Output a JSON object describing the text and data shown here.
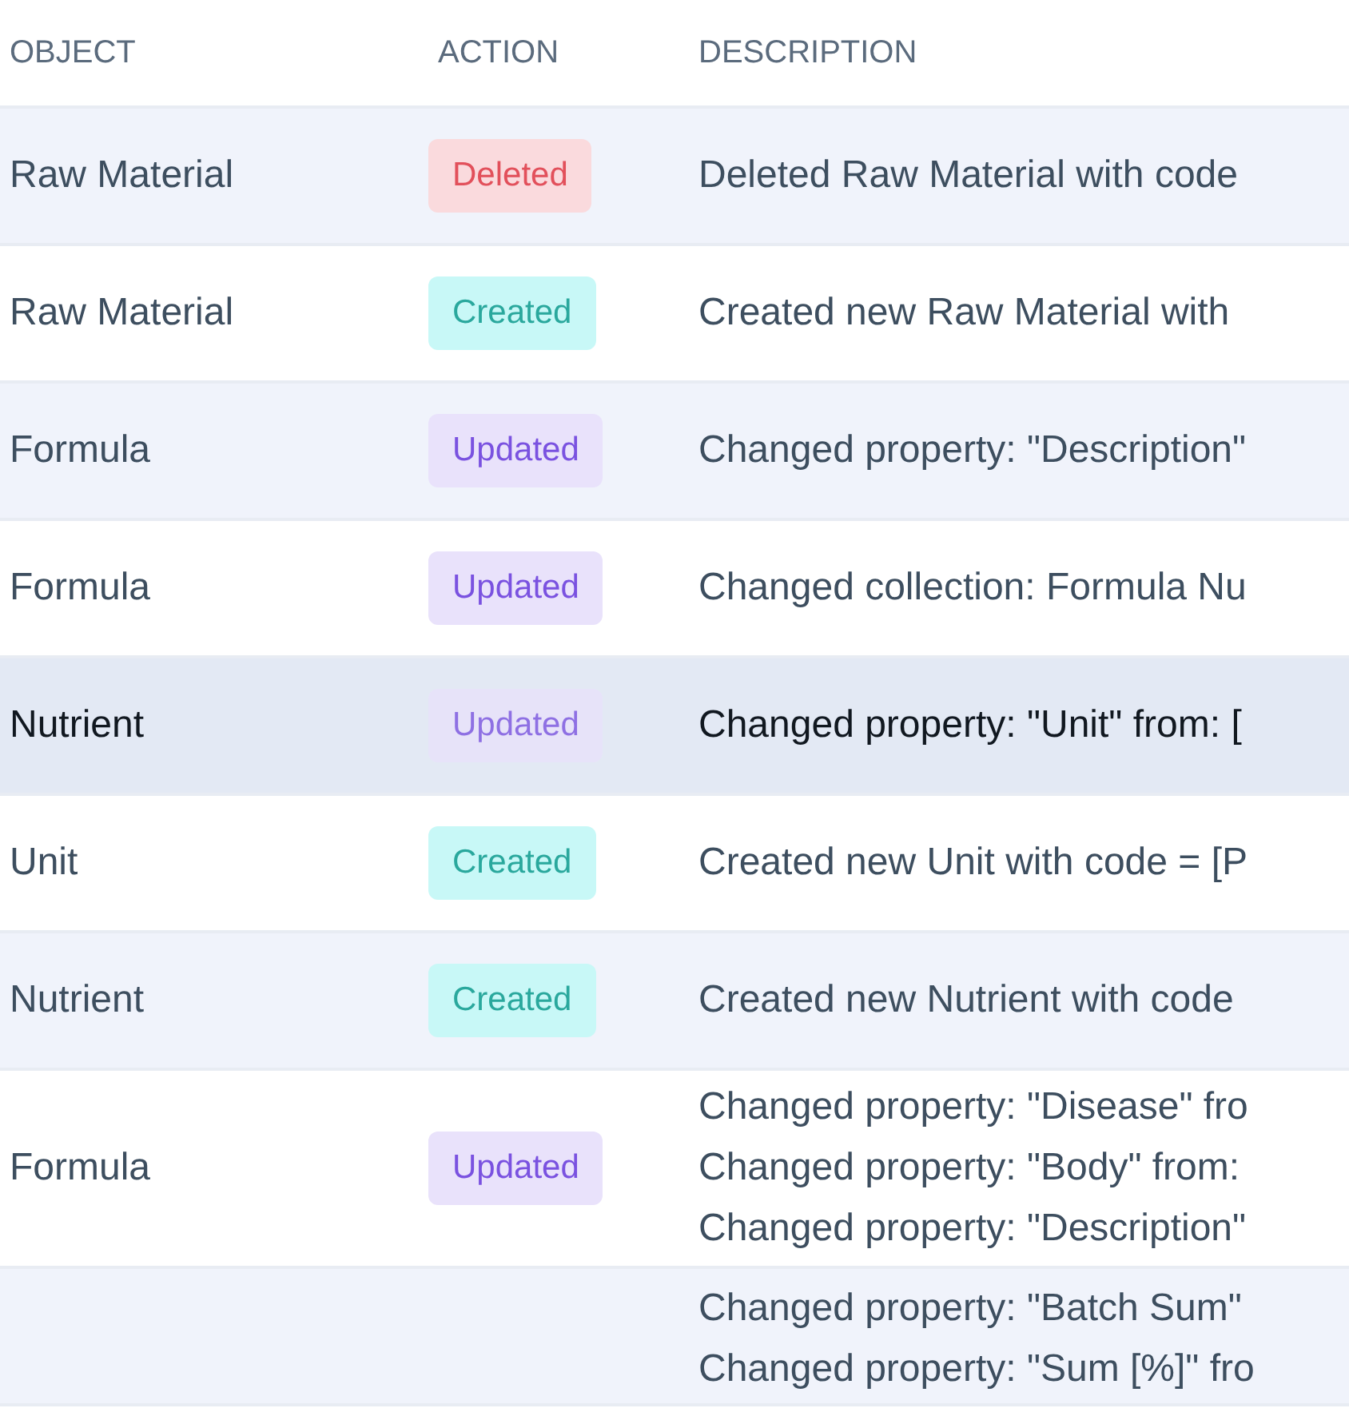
{
  "table": {
    "columns": [
      "OBJECT",
      "ACTION",
      "DESCRIPTION"
    ],
    "rows": [
      {
        "object": "Raw Material",
        "action": {
          "kind": "deleted",
          "label": "Deleted"
        },
        "description": [
          "Deleted Raw Material with code"
        ],
        "selected": false
      },
      {
        "object": "Raw Material",
        "action": {
          "kind": "created",
          "label": "Created"
        },
        "description": [
          "Created new Raw Material with"
        ],
        "selected": false
      },
      {
        "object": "Formula",
        "action": {
          "kind": "updated",
          "label": "Updated"
        },
        "description": [
          "Changed property: \"Description\""
        ],
        "selected": false
      },
      {
        "object": "Formula",
        "action": {
          "kind": "updated",
          "label": "Updated"
        },
        "description": [
          "Changed collection: Formula Nu"
        ],
        "selected": false
      },
      {
        "object": "Nutrient",
        "action": {
          "kind": "updated",
          "label": "Updated"
        },
        "description": [
          "Changed property: \"Unit\" from: ["
        ],
        "selected": true
      },
      {
        "object": "Unit",
        "action": {
          "kind": "created",
          "label": "Created"
        },
        "description": [
          "Created new Unit with code = [P"
        ],
        "selected": false
      },
      {
        "object": "Nutrient",
        "action": {
          "kind": "created",
          "label": "Created"
        },
        "description": [
          "Created new Nutrient with code"
        ],
        "selected": false
      },
      {
        "object": "Formula",
        "action": {
          "kind": "updated",
          "label": "Updated"
        },
        "description": [
          "Changed property: \"Disease\" fro",
          "Changed property: \"Body\" from:",
          "Changed property: \"Description\""
        ],
        "selected": false
      },
      {
        "description": [
          "Changed property: \"Batch Sum\"",
          "Changed property: \"Sum [%]\" fro"
        ],
        "selected": false
      }
    ]
  }
}
